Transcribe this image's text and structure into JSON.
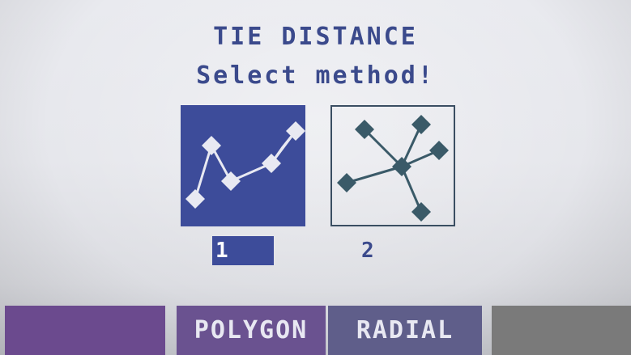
{
  "header": {
    "title": "TIE DISTANCE",
    "subtitle": "Select method!"
  },
  "methods": [
    {
      "number": "1",
      "icon": "polygon-traverse-icon",
      "selected": true
    },
    {
      "number": "2",
      "icon": "radial-network-icon",
      "selected": false
    }
  ],
  "softkeys": [
    "",
    "POLYGON",
    "RADIAL",
    ""
  ],
  "colors": {
    "accent": "#3d4c9a",
    "text": "#3b4a8c",
    "screen_bg": "#e6e7ec",
    "icon_node_dark": "#3a5a68",
    "softkey_purple": "#6a5290",
    "softkey_gray": "#7a7a7a"
  }
}
